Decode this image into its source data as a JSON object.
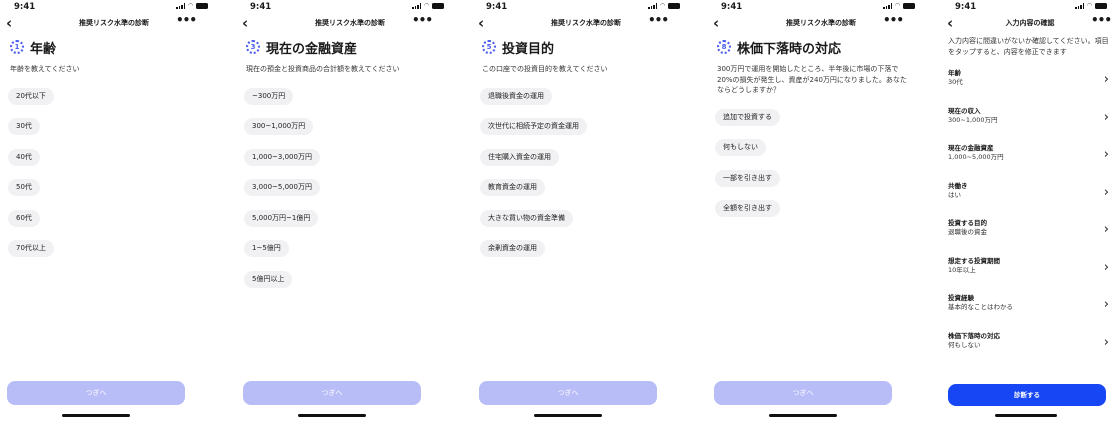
{
  "status": {
    "time": "9:41"
  },
  "screens": [
    {
      "nav_title": "推奨リスク水準の診断",
      "step_icon": "dotted-progress-ring-icon",
      "question_title": "年齢",
      "description": "年齢を教えてください",
      "options": [
        "20代以下",
        "30代",
        "40代",
        "50代",
        "60代",
        "70代以上"
      ],
      "next_label": "つぎへ"
    },
    {
      "nav_title": "推奨リスク水準の診断",
      "step_icon": "dotted-progress-ring-icon",
      "question_title": "現在の金融資産",
      "description": "現在の預金と投資商品の合計額を教えてください",
      "options": [
        "~300万円",
        "300~1,000万円",
        "1,000~3,000万円",
        "3,000~5,000万円",
        "5,000万円~1億円",
        "1~5億円",
        "5億円以上"
      ],
      "next_label": "つぎへ"
    },
    {
      "nav_title": "推奨リスク水準の診断",
      "step_icon": "dotted-progress-ring-icon",
      "question_title": "投資目的",
      "description": "この口座での投資目的を教えてください",
      "options": [
        "退職後資金の運用",
        "次世代に相続予定の資金運用",
        "住宅購入資金の運用",
        "教育資金の運用",
        "大きな買い物の資金準備",
        "余剰資金の運用"
      ],
      "next_label": "つぎへ"
    },
    {
      "nav_title": "推奨リスク水準の診断",
      "step_icon": "dotted-progress-ring-icon",
      "question_title": "株価下落時の対応",
      "description": "300万円で運用を開始したところ、半年後に市場の下落で20%の損失が発生し、資産が240万円になりました。あなたならどうしますか？",
      "options": [
        "追加で投資する",
        "何もしない",
        "一部を引き出す",
        "全額を引き出す"
      ],
      "next_label": "つぎへ"
    }
  ],
  "review": {
    "nav_title": "入力内容の確認",
    "description": "入力内容に間違いがないか確認してください。項目をタップすると、内容を修正できます",
    "items": [
      {
        "label": "年齢",
        "value": "30代"
      },
      {
        "label": "現在の収入",
        "value": "300~1,000万円"
      },
      {
        "label": "現在の金融資産",
        "value": "1,000~5,000万円"
      },
      {
        "label": "共働き",
        "value": "はい"
      },
      {
        "label": "投資する目的",
        "value": "退職後の資金"
      },
      {
        "label": "想定する投資期間",
        "value": "10年以上"
      },
      {
        "label": "投資経験",
        "value": "基本的なことはわかる"
      },
      {
        "label": "株価下落時の対応",
        "value": "何もしない"
      }
    ],
    "submit_label": "診断する"
  },
  "colors": {
    "accent": "#1746f5",
    "next_disabled": "#b8bcf7",
    "option_bg": "#f1f1f3",
    "step_ring": "#4a5cf0"
  }
}
